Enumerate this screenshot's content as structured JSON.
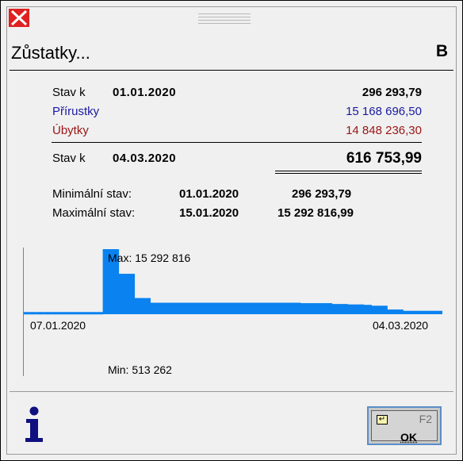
{
  "window": {
    "title": "Zůstatky...",
    "title_right": "B"
  },
  "balances": {
    "start": {
      "label": "Stav k",
      "date": "01.01.2020",
      "amount": "296 293,79"
    },
    "increases": {
      "label": "Přírustky",
      "amount": "15 168 696,50",
      "color": "#1a1aa0"
    },
    "decreases": {
      "label": "Úbytky",
      "amount": "14 848 236,30",
      "color": "#9a1515"
    },
    "end": {
      "label": "Stav k",
      "date": "04.03.2020",
      "amount": "616 753,99"
    }
  },
  "extremes": {
    "min": {
      "label": "Minimální stav:",
      "date": "01.01.2020",
      "amount": "296 293,79"
    },
    "max": {
      "label": "Maximální stav:",
      "date": "15.01.2020",
      "amount": "15 292 816,99"
    }
  },
  "chart_data": {
    "type": "area",
    "x_start_label": "07.01.2020",
    "x_end_label": "04.03.2020",
    "max_label": "Max: 15 292 816",
    "min_label": "Min: 513 262",
    "values": [
      513262,
      513262,
      513262,
      513262,
      513262,
      513262,
      513262,
      513262,
      513262,
      513262,
      15292816,
      15292816,
      9500000,
      9500000,
      3800000,
      3800000,
      2700000,
      2700000,
      2700000,
      2700000,
      2700000,
      2700000,
      2700000,
      2700000,
      2700000,
      2700000,
      2700000,
      2700000,
      2700000,
      2700000,
      2700000,
      2700000,
      2700000,
      2700000,
      2700000,
      2600000,
      2600000,
      2600000,
      2600000,
      2400000,
      2400000,
      2300000,
      2300000,
      2200000,
      2000000,
      2000000,
      1100000,
      1100000,
      800000,
      800000,
      800000,
      800000,
      800000
    ],
    "color": "#0a82f0"
  },
  "footer": {
    "ok_label": "OK",
    "ok_hotkey": "F2"
  }
}
